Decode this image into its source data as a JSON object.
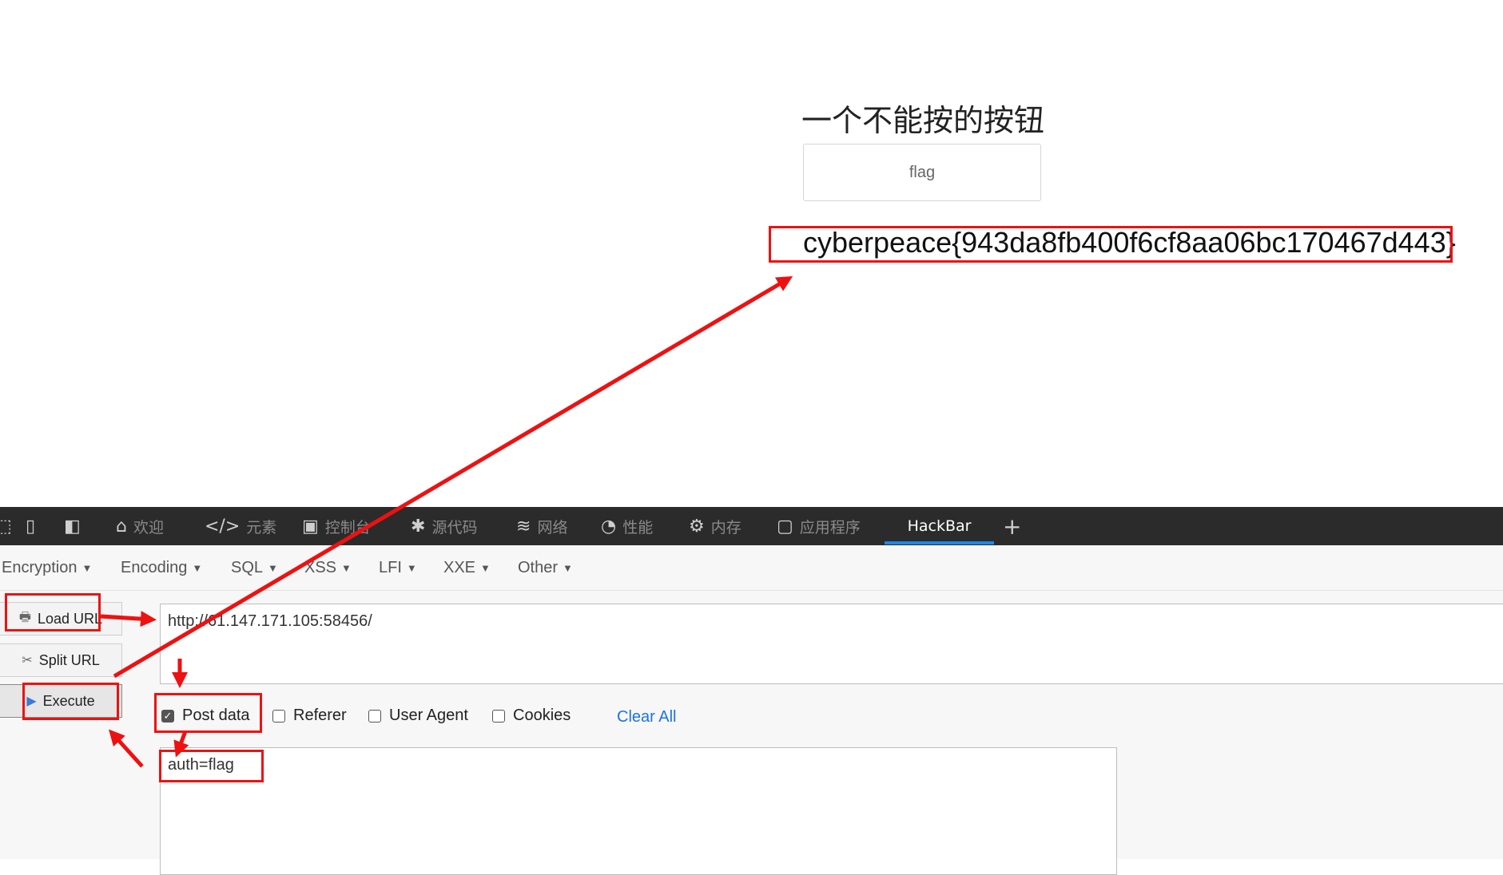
{
  "page": {
    "heading": "一个不能按的按钮",
    "button_label": "flag",
    "flag_text": "cyberpeace{943da8fb400f6cf8aa06bc170467d443}"
  },
  "devtools": {
    "tabs": [
      {
        "label": "欢迎",
        "icon": "home-icon"
      },
      {
        "label": "元素",
        "icon": "code-icon"
      },
      {
        "label": "控制台",
        "icon": "console-icon"
      },
      {
        "label": "源代码",
        "icon": "bug-icon"
      },
      {
        "label": "网络",
        "icon": "wifi-icon"
      },
      {
        "label": "性能",
        "icon": "gauge-icon"
      },
      {
        "label": "内存",
        "icon": "chip-icon"
      },
      {
        "label": "应用程序",
        "icon": "app-icon"
      },
      {
        "label": "HackBar",
        "icon": ""
      }
    ],
    "add_tab_icon": "plus-icon",
    "active_tab": "HackBar",
    "accent_color": "#1e88e5"
  },
  "hackbar": {
    "menus": [
      "Encryption",
      "Encoding",
      "SQL",
      "XSS",
      "LFI",
      "XXE",
      "Other"
    ],
    "buttons": {
      "load_url": "Load URL",
      "split_url": "Split URL",
      "execute": "Execute"
    },
    "url": "http://61.147.171.105:58456/",
    "options": [
      {
        "label": "Post data",
        "checked": true
      },
      {
        "label": "Referer",
        "checked": false
      },
      {
        "label": "User Agent",
        "checked": false
      },
      {
        "label": "Cookies",
        "checked": false
      }
    ],
    "clear_all": "Clear All",
    "post_body": "auth=flag"
  },
  "annotation_color": "#ee1111"
}
